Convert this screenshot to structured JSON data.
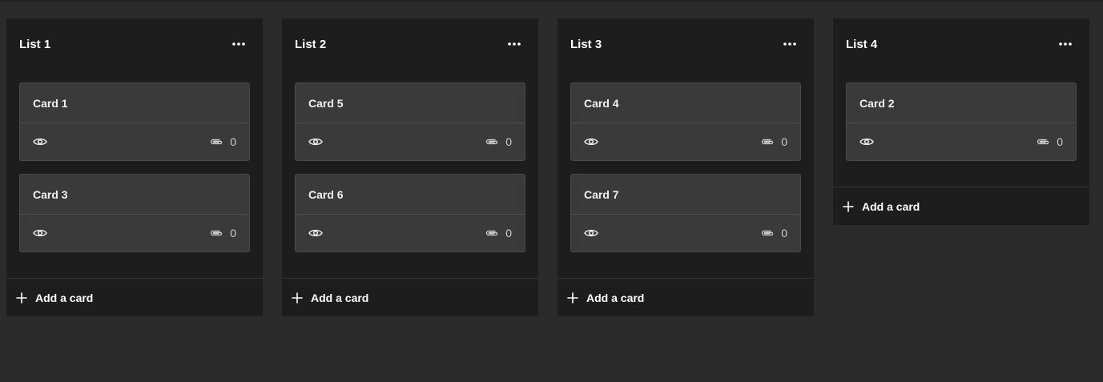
{
  "lists": [
    {
      "title": "List 1",
      "add_label": "Add a card",
      "cards": [
        {
          "title": "Card 1",
          "attachments": "0"
        },
        {
          "title": "Card 3",
          "attachments": "0"
        }
      ]
    },
    {
      "title": "List 2",
      "add_label": "Add a card",
      "cards": [
        {
          "title": "Card 5",
          "attachments": "0"
        },
        {
          "title": "Card 6",
          "attachments": "0"
        }
      ]
    },
    {
      "title": "List 3",
      "add_label": "Add a card",
      "cards": [
        {
          "title": "Card 4",
          "attachments": "0"
        },
        {
          "title": "Card 7",
          "attachments": "0"
        }
      ]
    },
    {
      "title": "List 4",
      "add_label": "Add a card",
      "cards": [
        {
          "title": "Card 2",
          "attachments": "0"
        }
      ]
    }
  ],
  "icons": {
    "menu": "more-horizontal-icon",
    "watch": "eye-icon",
    "attachment": "paperclip-icon",
    "add": "plus-icon"
  },
  "colors": {
    "background": "#2b2b2b",
    "list": "#1d1d1d",
    "card": "#3a3a3a",
    "text": "#ffffff"
  }
}
